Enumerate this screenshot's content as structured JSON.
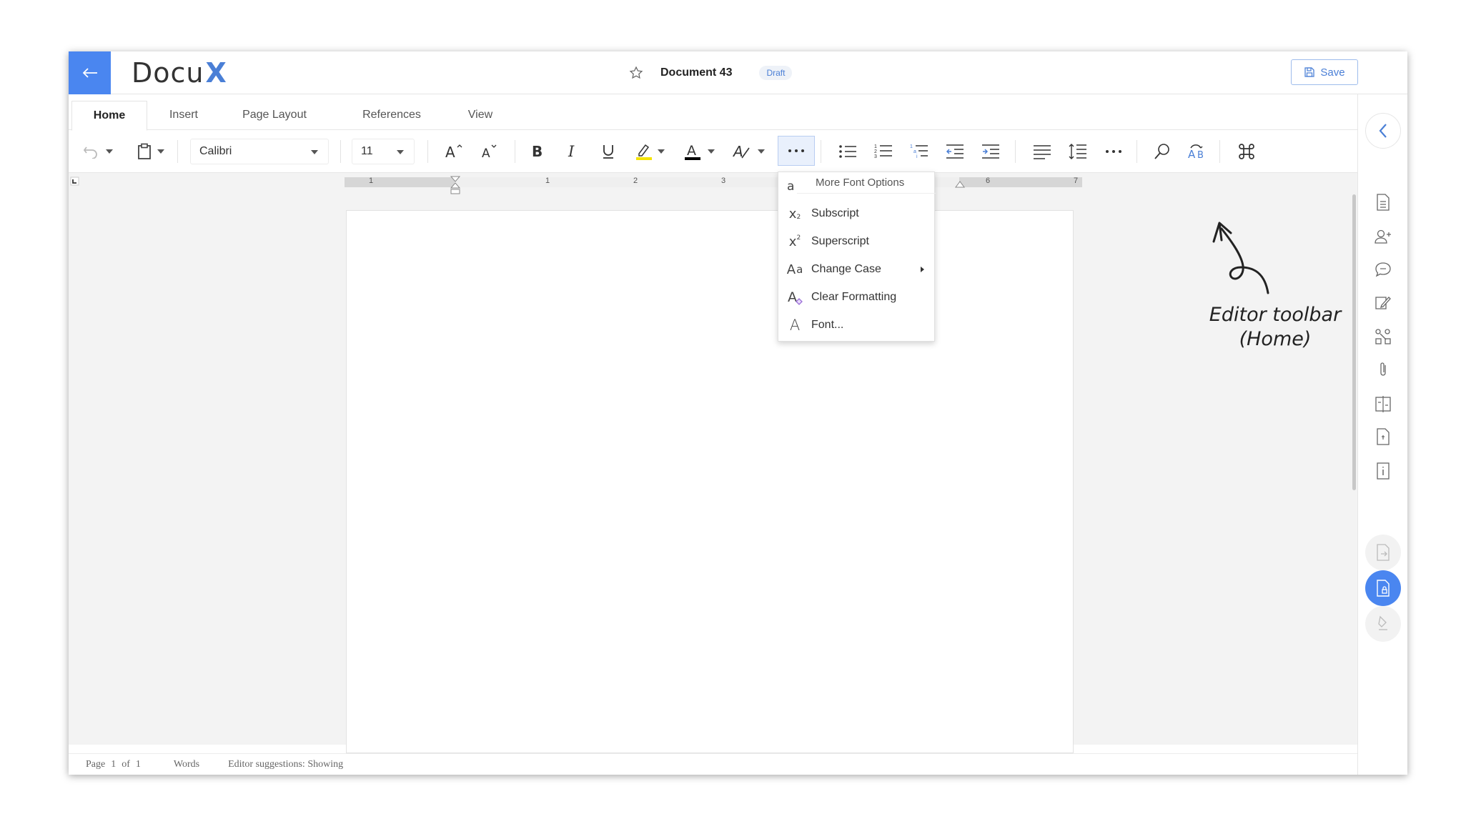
{
  "header": {
    "logo_text": "Docu",
    "logo_mark": "X",
    "document_title": "Document 43",
    "status_badge": "Draft",
    "save_label": "Save"
  },
  "tabs": [
    {
      "label": "Home",
      "active": true
    },
    {
      "label": "Insert",
      "active": false
    },
    {
      "label": "Page Layout",
      "active": false
    },
    {
      "label": "References",
      "active": false
    },
    {
      "label": "View",
      "active": false
    }
  ],
  "toolbar": {
    "font_family": "Calibri",
    "font_size": "11",
    "icons": [
      "undo-icon",
      "paste-icon",
      "grow-font-icon",
      "shrink-font-icon",
      "bold-icon",
      "italic-icon",
      "underline-icon",
      "highlight-icon",
      "font-color-icon",
      "text-effects-icon",
      "more-font-options-icon",
      "bullet-list-icon",
      "numbered-list-icon",
      "multilevel-list-icon",
      "decrease-indent-icon",
      "increase-indent-icon",
      "align-left-icon",
      "line-spacing-icon",
      "more-paragraph-icon",
      "find-icon",
      "spelling-icon",
      "command-icon"
    ],
    "highlight_color": "#f5e400",
    "font_color": "#000000"
  },
  "ruler": {
    "labels": [
      "1",
      "1",
      "2",
      "3",
      "6",
      "7"
    ]
  },
  "font_menu": {
    "header": "More Font Options",
    "items": [
      {
        "icon": "subscript-icon",
        "label": "Subscript"
      },
      {
        "icon": "superscript-icon",
        "label": "Superscript"
      },
      {
        "icon": "change-case-icon",
        "label": "Change Case",
        "has_submenu": true
      },
      {
        "icon": "clear-formatting-icon",
        "label": "Clear Formatting"
      },
      {
        "icon": "font-icon",
        "label": "Font..."
      }
    ]
  },
  "status_bar": {
    "page_label": "Page",
    "page_current": "1",
    "page_of": "of",
    "page_total": "1",
    "words_label": "Words",
    "suggestions": "Editor suggestions: Showing"
  },
  "annotation": {
    "line1": "Editor toolbar",
    "line2": "(Home)"
  },
  "sidebar": {
    "icons": [
      "collapse-icon",
      "document-details-icon",
      "add-user-icon",
      "comments-icon",
      "sign-icon",
      "workflow-icon",
      "attachment-icon",
      "compare-icon",
      "page-icon",
      "info-icon",
      "export-icon",
      "secure-document-icon",
      "signature-icon"
    ]
  },
  "colors": {
    "accent": "#4a86f0",
    "brand": "#4a7fd6"
  }
}
